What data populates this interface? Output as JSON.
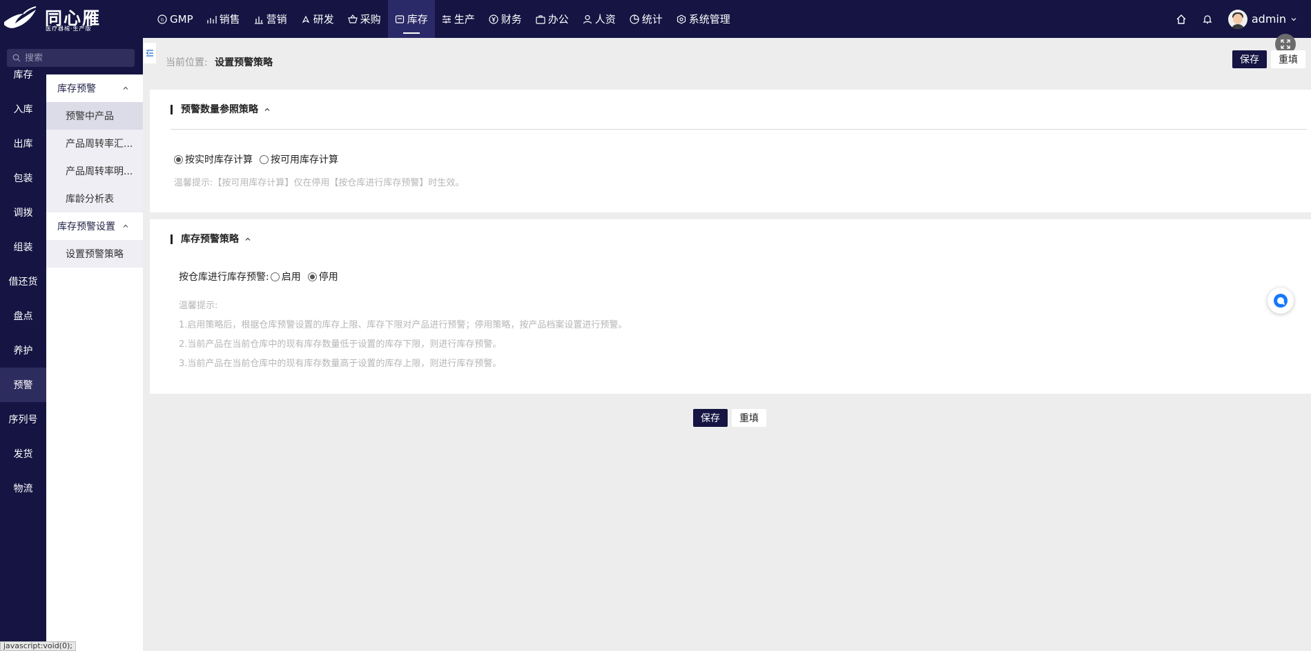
{
  "brand": {
    "name": "同心雁",
    "subtitle": "医疗器械·生产版"
  },
  "topnav": [
    {
      "label": "GMP",
      "icon": "gmp-icon"
    },
    {
      "label": "销售",
      "icon": "sales-chart-icon"
    },
    {
      "label": "营销",
      "icon": "bar-chart-icon"
    },
    {
      "label": "研发",
      "icon": "rocket-icon"
    },
    {
      "label": "采购",
      "icon": "basket-icon"
    },
    {
      "label": "库存",
      "icon": "inventory-icon"
    },
    {
      "label": "生产",
      "icon": "production-icon"
    },
    {
      "label": "财务",
      "icon": "yen-icon"
    },
    {
      "label": "办公",
      "icon": "briefcase-icon"
    },
    {
      "label": "人资",
      "icon": "person-icon"
    },
    {
      "label": "统计",
      "icon": "pie-icon"
    },
    {
      "label": "系统管理",
      "icon": "settings-icon"
    }
  ],
  "topnav_active": "库存",
  "user": {
    "name": "admin"
  },
  "search": {
    "placeholder": "搜索"
  },
  "side_menu": [
    "库存",
    "入库",
    "出库",
    "包装",
    "调拨",
    "组装",
    "借还货",
    "盘点",
    "养护",
    "预警",
    "序列号",
    "发货",
    "物流"
  ],
  "side_menu_active": "预警",
  "sub_menu": {
    "group1": {
      "label": "库存预警",
      "items": [
        "预警中产品",
        "产品周转率汇...",
        "产品周转率明...",
        "库龄分析表"
      ]
    },
    "group2": {
      "label": "库存预警设置",
      "items": [
        "设置预警策略"
      ]
    }
  },
  "breadcrumb": {
    "label": "当前位置:",
    "current": "设置预警策略"
  },
  "actions": {
    "save": "保存",
    "reset": "重填"
  },
  "section1": {
    "title": "预警数量参照策略",
    "options": [
      "按实时库存计算",
      "按可用库存计算"
    ],
    "selected": "按实时库存计算",
    "hint": "温馨提示:【按可用库存计算】仅在停用【按仓库进行库存预警】时生效。"
  },
  "section2": {
    "title": "库存预警策略",
    "field_label": "按仓库进行库存预警:",
    "options": [
      "启用",
      "停用"
    ],
    "selected": "停用",
    "hint_title": "温馨提示:",
    "hints": [
      "1.启用策略后，根据仓库预警设置的库存上限、库存下限对产品进行预警；停用策略，按产品档案设置进行预警。",
      "2.当前产品在当前仓库中的现有库存数量低于设置的库存下限，则进行库存预警。",
      "3.当前产品在当前仓库中的现有库存数量高于设置的库存上限，则进行库存预警。"
    ]
  },
  "status_url": "javascript:void(0);"
}
